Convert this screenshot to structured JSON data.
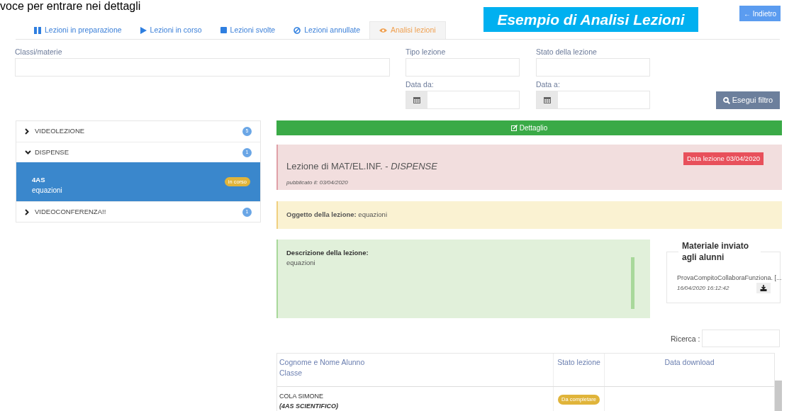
{
  "caption": "voce per entrare nei dettagli",
  "banner": "Esempio di Analisi Lezioni",
  "back_button": {
    "icon": "←",
    "label": "Indietro"
  },
  "tabs": [
    {
      "label": "Lezioni in preparazione",
      "kind": "pause",
      "selected": false
    },
    {
      "label": "Lezioni in corso",
      "kind": "play",
      "selected": false
    },
    {
      "label": "Lezioni svolte",
      "kind": "stop",
      "selected": false
    },
    {
      "label": "Lezioni annullate",
      "kind": "ban",
      "selected": false
    },
    {
      "label": "Analisi lezioni",
      "kind": "eye",
      "selected": true
    }
  ],
  "filters": {
    "classes_label": "Classi/materie",
    "type_label": "Tipo lezione",
    "state_label": "Stato della lezione",
    "from_label": "Data da:",
    "to_label": "Data a:",
    "button": "Esegui filtro"
  },
  "sidebar": {
    "items": [
      {
        "label": "VIDEOLEZIONE",
        "count": "5",
        "expanded": false
      },
      {
        "label": "DISPENSE",
        "count": "1",
        "expanded": true,
        "children": [
          {
            "class": "4AS",
            "topic": "equazioni",
            "badge": "in corso",
            "selected": true
          }
        ]
      },
      {
        "label": "VIDEOCONFERENZA!!",
        "count": "1",
        "expanded": false
      }
    ]
  },
  "detail": {
    "header": "Dettaglio",
    "title": "Lezione di MAT/EL.INF. - *DISPENSE*",
    "published": "pubblicato il: 03/04/2020",
    "date_badge": "Data lezione 03/04/2020",
    "subject": "**Oggetto della lezione:** equazioni",
    "description_label": "Descrizione della lezione:",
    "description": "equazioni",
    "material": {
      "title": "Materiale inviato agli alunni",
      "file": "ProvaCompitoCollaboraFunziona. [...",
      "timestamp": "16/04/2020 16:12:42"
    }
  },
  "search_label": "Ricerca :",
  "table": {
    "columns": [
      "Cognome e Nome Alunno\nClasse",
      "Stato lezione",
      "Data download"
    ],
    "rows": [
      {
        "name": "COLA SIMONE",
        "class": "(4AS SCIENTIFICO)",
        "status": "Da completare"
      }
    ]
  }
}
